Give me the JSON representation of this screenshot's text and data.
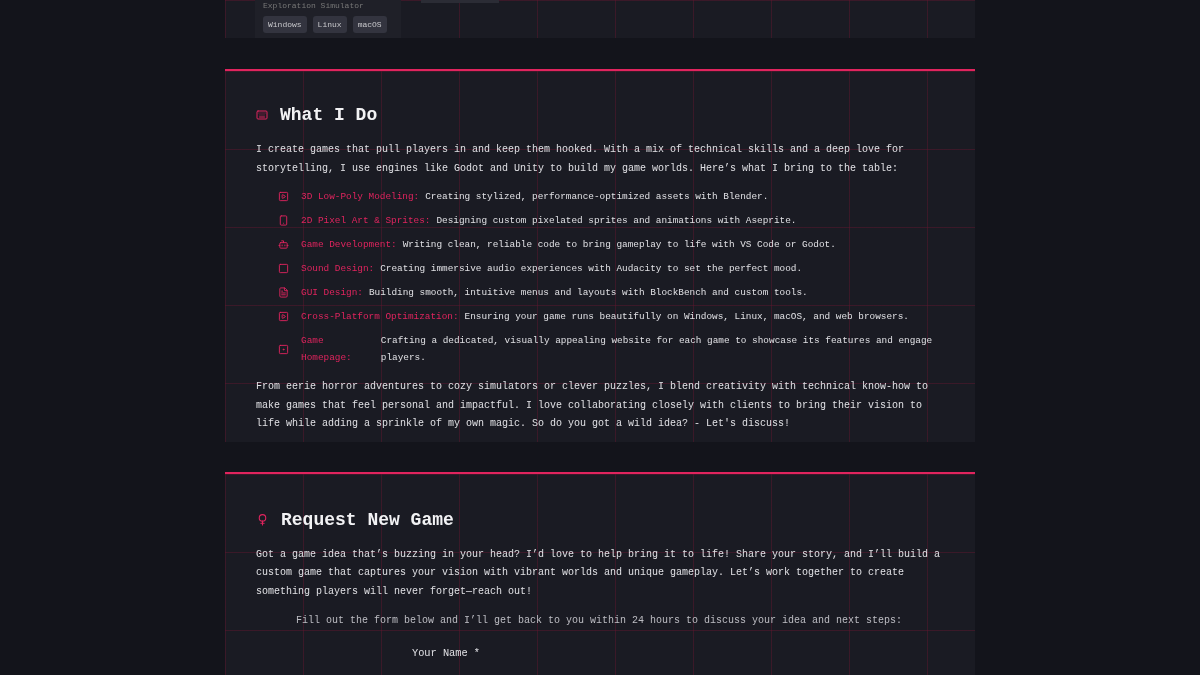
{
  "top_card": {
    "subtitle": "Exploration Simulator",
    "platforms": [
      "Windows",
      "Linux",
      "macOS"
    ]
  },
  "what_i_do": {
    "title": "What I Do",
    "intro": "I create games that pull players in and keep them hooked. With a mix of technical skills and a deep love for storytelling, I use engines like Godot and Unity to build my game worlds. Here’s what I bring to the table:",
    "items": [
      {
        "label": "3D Low-Poly Modeling:",
        "text": "Creating stylized, performance-optimized assets with Blender."
      },
      {
        "label": "2D Pixel Art & Sprites:",
        "text": "Designing custom pixelated sprites and animations with Aseprite."
      },
      {
        "label": "Game Development:",
        "text": "Writing clean, reliable code to bring gameplay to life with VS Code or Godot."
      },
      {
        "label": "Sound Design:",
        "text": "Creating immersive audio experiences with Audacity to set the perfect mood."
      },
      {
        "label": "GUI Design:",
        "text": "Building smooth, intuitive menus and layouts with BlockBench and custom tools."
      },
      {
        "label": "Cross-Platform Optimization:",
        "text": "Ensuring your game runs beautifully on Windows, Linux, macOS, and web browsers."
      },
      {
        "label": "Game Homepage:",
        "text": "Crafting a dedicated, visually appealing website for each game to showcase its features and engage players."
      }
    ],
    "outro": "From eerie horror adventures to cozy simulators or clever puzzles, I blend creativity with technical know-how to make games that feel personal and impactful. I love collaborating closely with clients to bring their vision to life while adding a sprinkle of my own magic. So do you got a wild idea? - Let's discuss!"
  },
  "request": {
    "title": "Request New Game",
    "intro": "Got a game idea that’s buzzing in your head? I’d love to help bring it to life! Share your story, and I’ll build a custom game that captures your vision with vibrant worlds and unique gameplay. Let’s work together to create something players will never forget—reach out!",
    "note": "Fill out the form below and I’ll get back to you within 24 hours to discuss your idea and next steps:",
    "field_label": "Your Name *"
  }
}
